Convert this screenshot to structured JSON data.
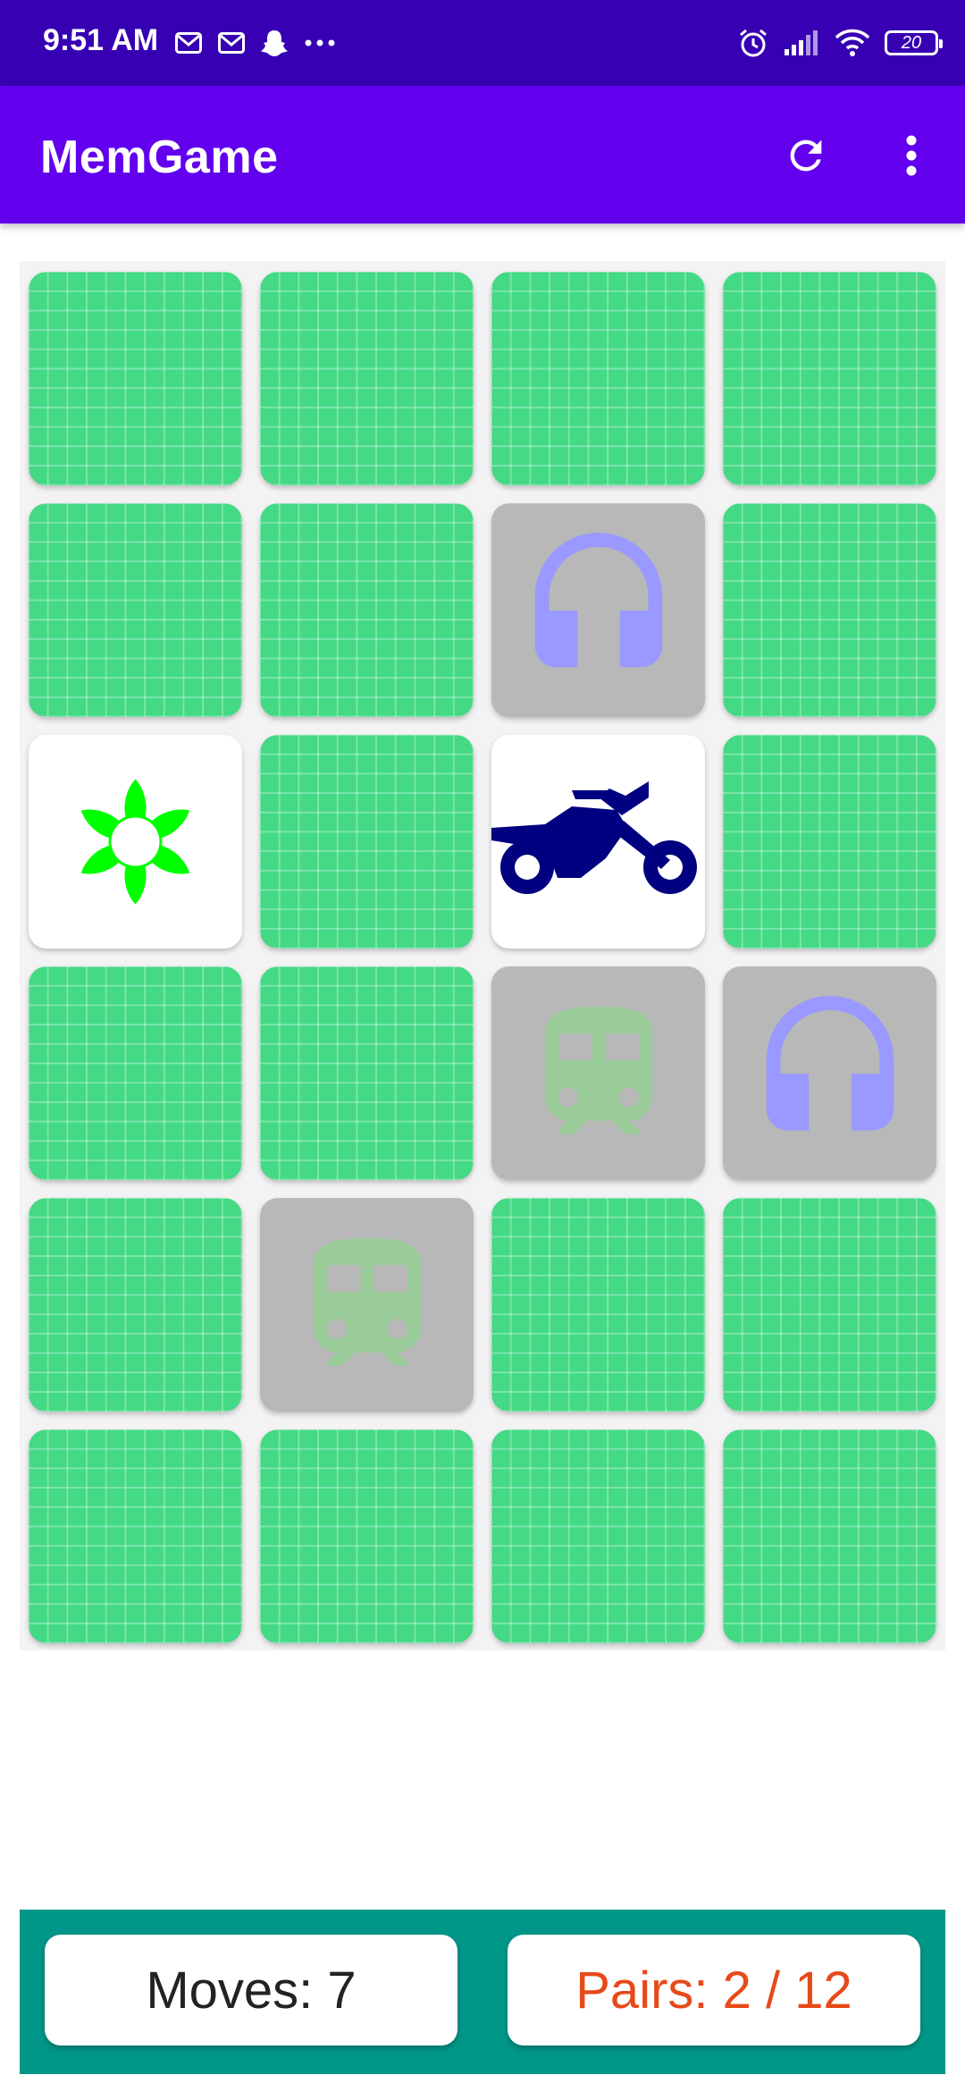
{
  "status_bar": {
    "time": "9:51 AM",
    "left_icons": [
      "gmail-icon",
      "gmail-icon",
      "snapchat-icon",
      "more-notifications-icon"
    ],
    "right_icons": [
      "alarm-icon",
      "signal-icon",
      "wifi-icon",
      "battery-icon"
    ],
    "battery_level": "20"
  },
  "app_bar": {
    "title": "MemGame",
    "actions": [
      "refresh-icon",
      "more-vert-icon"
    ],
    "background": "#6200ee"
  },
  "board": {
    "columns": 4,
    "rows": 6,
    "card_back_color": "#43d985",
    "cards": [
      {
        "state": "hidden"
      },
      {
        "state": "hidden"
      },
      {
        "state": "hidden"
      },
      {
        "state": "hidden"
      },
      {
        "state": "hidden"
      },
      {
        "state": "hidden"
      },
      {
        "state": "matched",
        "icon": "headphones-icon",
        "color": "#9999ff"
      },
      {
        "state": "hidden"
      },
      {
        "state": "open",
        "icon": "flower-icon",
        "color": "#00ff00"
      },
      {
        "state": "hidden"
      },
      {
        "state": "open",
        "icon": "motorcycle-icon",
        "color": "#000080"
      },
      {
        "state": "hidden"
      },
      {
        "state": "hidden"
      },
      {
        "state": "hidden"
      },
      {
        "state": "matched",
        "icon": "train-icon",
        "color": "#99cc99"
      },
      {
        "state": "matched",
        "icon": "headphones-icon",
        "color": "#9999ff"
      },
      {
        "state": "hidden"
      },
      {
        "state": "matched",
        "icon": "train-icon",
        "color": "#99cc99"
      },
      {
        "state": "hidden"
      },
      {
        "state": "hidden"
      },
      {
        "state": "hidden"
      },
      {
        "state": "hidden"
      },
      {
        "state": "hidden"
      },
      {
        "state": "hidden"
      }
    ]
  },
  "stats": {
    "moves": "Moves: 7",
    "pairs": "Pairs: 2 / 12",
    "moves_color": "#222222",
    "pairs_color": "#e64a19",
    "bar_color": "#009688"
  }
}
